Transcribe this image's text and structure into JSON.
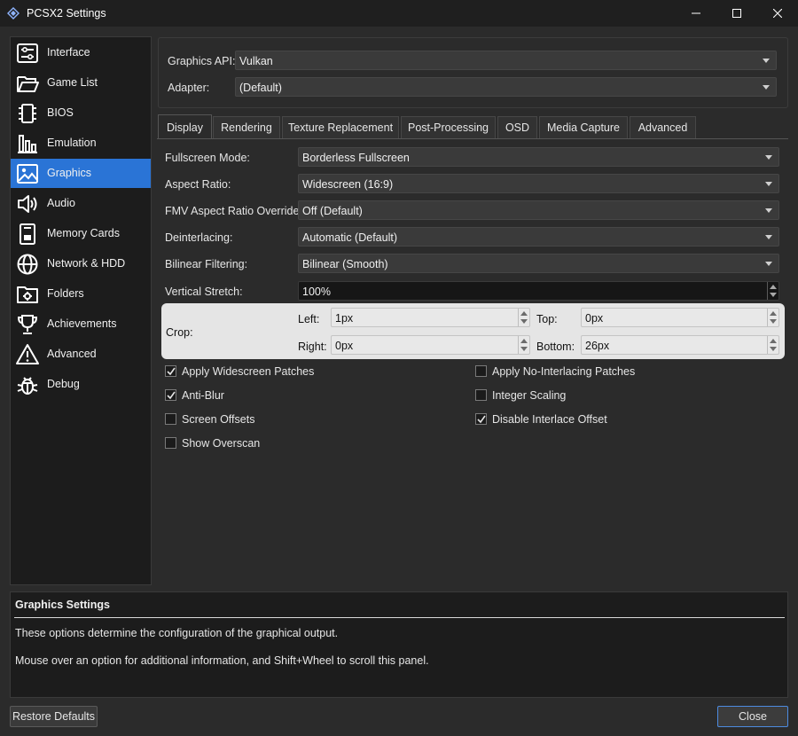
{
  "window": {
    "title": "PCSX2 Settings",
    "icon": "pcsx2-logo-icon"
  },
  "sidebar": {
    "items": [
      {
        "label": "Interface",
        "icon": "interface-settings-icon"
      },
      {
        "label": "Game List",
        "icon": "folder-open-icon"
      },
      {
        "label": "BIOS",
        "icon": "chip-icon"
      },
      {
        "label": "Emulation",
        "icon": "emulation-chart-icon"
      },
      {
        "label": "Graphics",
        "icon": "image-icon",
        "active": true
      },
      {
        "label": "Audio",
        "icon": "speaker-icon"
      },
      {
        "label": "Memory Cards",
        "icon": "memory-card-icon"
      },
      {
        "label": "Network & HDD",
        "icon": "globe-icon"
      },
      {
        "label": "Folders",
        "icon": "folder-gear-icon"
      },
      {
        "label": "Achievements",
        "icon": "trophy-icon"
      },
      {
        "label": "Advanced",
        "icon": "warning-icon"
      },
      {
        "label": "Debug",
        "icon": "bug-icon"
      }
    ]
  },
  "api": {
    "graphics_api_label": "Graphics API:",
    "graphics_api_value": "Vulkan",
    "adapter_label": "Adapter:",
    "adapter_value": "(Default)"
  },
  "tabs": [
    {
      "label": "Display",
      "active": true
    },
    {
      "label": "Rendering"
    },
    {
      "label": "Texture Replacement"
    },
    {
      "label": "Post-Processing"
    },
    {
      "label": "OSD"
    },
    {
      "label": "Media Capture"
    },
    {
      "label": "Advanced"
    }
  ],
  "display": {
    "fullscreen_mode": {
      "label": "Fullscreen Mode:",
      "value": "Borderless Fullscreen"
    },
    "aspect_ratio": {
      "label": "Aspect Ratio:",
      "value": "Widescreen (16:9)"
    },
    "fmv_aspect": {
      "label": "FMV Aspect Ratio Override:",
      "value": "Off (Default)"
    },
    "deinterlacing": {
      "label": "Deinterlacing:",
      "value": "Automatic (Default)"
    },
    "bilinear": {
      "label": "Bilinear Filtering:",
      "value": "Bilinear (Smooth)"
    },
    "vertical_stretch": {
      "label": "Vertical Stretch:",
      "value": "100%"
    },
    "crop": {
      "label": "Crop:",
      "left_label": "Left:",
      "left_value": "1px",
      "top_label": "Top:",
      "top_value": "0px",
      "right_label": "Right:",
      "right_value": "0px",
      "bottom_label": "Bottom:",
      "bottom_value": "26px"
    },
    "checkboxes": [
      {
        "label": "Apply Widescreen Patches",
        "checked": true
      },
      {
        "label": "Apply No-Interlacing Patches",
        "checked": false
      },
      {
        "label": "Anti-Blur",
        "checked": true
      },
      {
        "label": "Integer Scaling",
        "checked": false
      },
      {
        "label": "Screen Offsets",
        "checked": false
      },
      {
        "label": "Disable Interlace Offset",
        "checked": true
      },
      {
        "label": "Show Overscan",
        "checked": false
      }
    ]
  },
  "info": {
    "title": "Graphics Settings",
    "line1": "These options determine the configuration of the graphical output.",
    "line2": "Mouse over an option for additional information, and Shift+Wheel to scroll this panel."
  },
  "footer": {
    "restore_label": "Restore Defaults",
    "close_label": "Close"
  },
  "colors": {
    "accent": "#2a74d6",
    "background": "#2b2b2b",
    "panel": "#1c1c1c"
  }
}
